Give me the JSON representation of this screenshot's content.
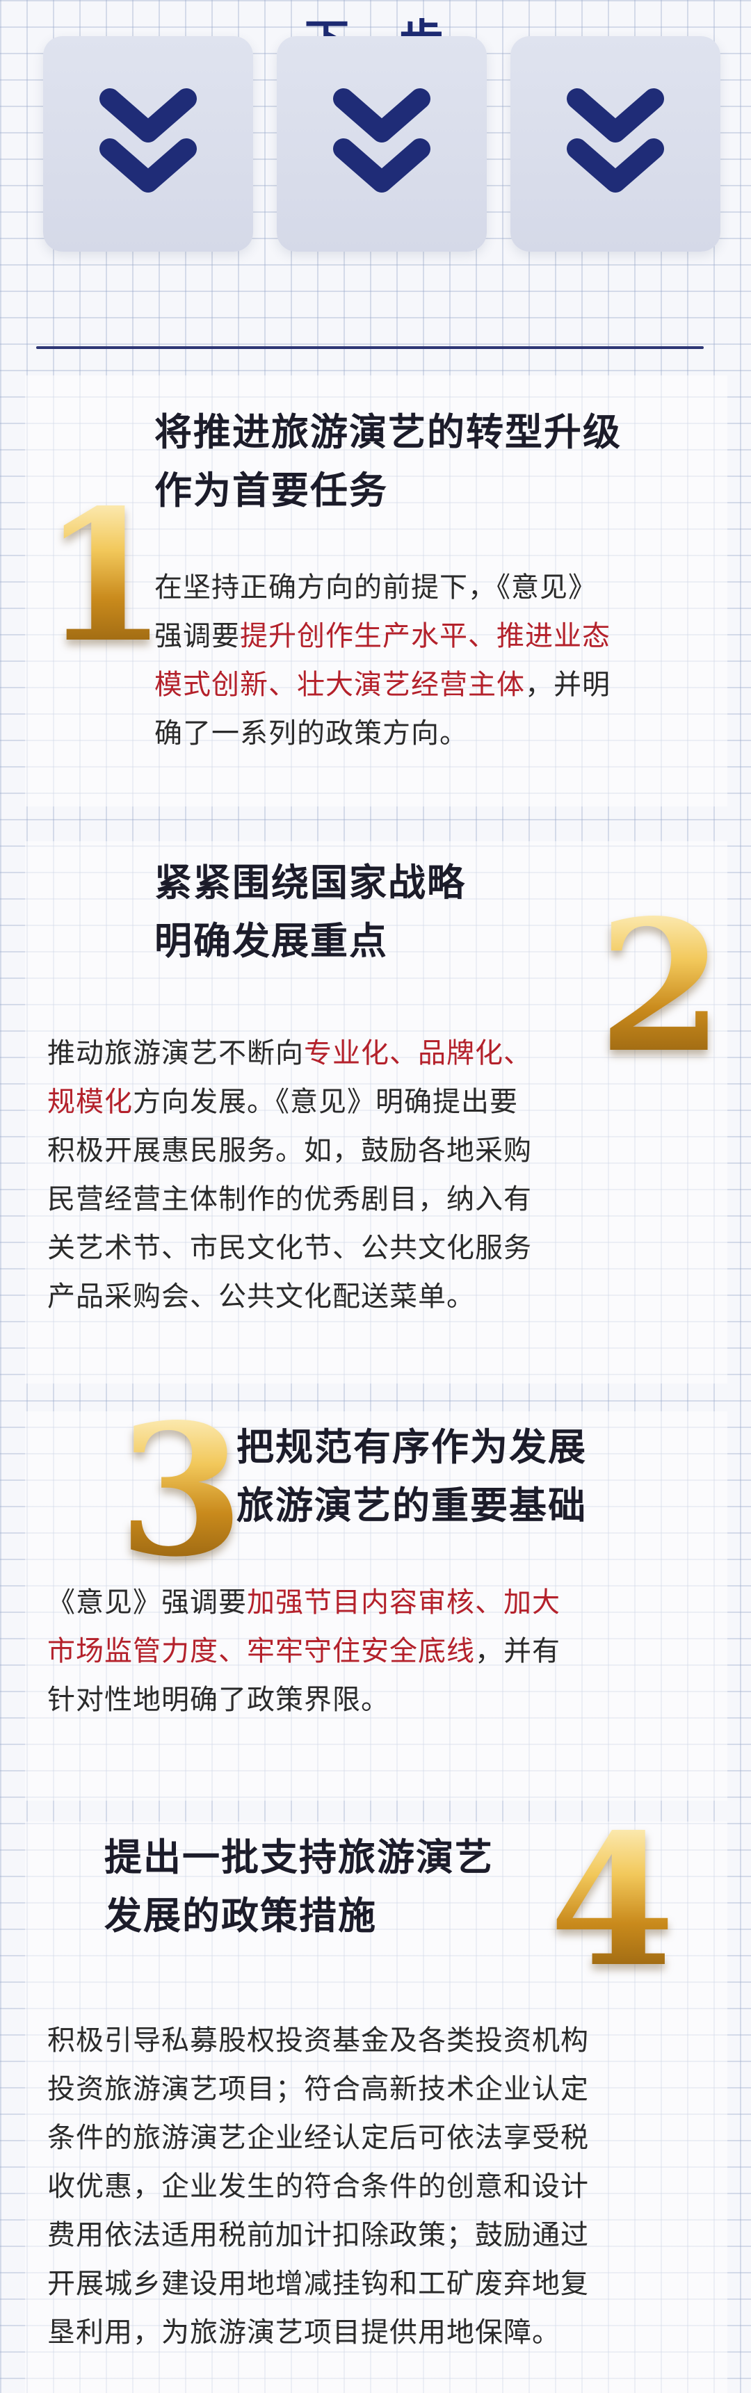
{
  "header": {
    "title": "下一步"
  },
  "sections": [
    {
      "number": "1",
      "heading_lines": [
        "将推进旅游演艺的转型升级",
        "作为首要任务"
      ],
      "body_lines": [
        [
          {
            "t": "在坚持正确方向的前提下，《意见》"
          }
        ],
        [
          {
            "t": "强调要"
          },
          {
            "t": "提升创作生产水平、推进业态",
            "hl": true
          }
        ],
        [
          {
            "t": "模式创新、壮大演艺经营主体",
            "hl": true
          },
          {
            "t": "，并明"
          }
        ],
        [
          {
            "t": "确了一系列的政策方向。"
          }
        ]
      ]
    },
    {
      "number": "2",
      "heading_lines": [
        "紧紧围绕国家战略",
        "明确发展重点"
      ],
      "body_lines": [
        [
          {
            "t": "推动旅游演艺不断向"
          },
          {
            "t": "专业化、品牌化、",
            "hl": true
          }
        ],
        [
          {
            "t": "规模化",
            "hl": true
          },
          {
            "t": "方向发展。《意见》明确提出要"
          }
        ],
        [
          {
            "t": "积极开展惠民服务。如，鼓励各地采购"
          }
        ],
        [
          {
            "t": "民营经营主体制作的优秀剧目，纳入有"
          }
        ],
        [
          {
            "t": "关艺术节、市民文化节、公共文化服务"
          }
        ],
        [
          {
            "t": "产品采购会、公共文化配送菜单。"
          }
        ]
      ]
    },
    {
      "number": "3",
      "heading_lines": [
        "把规范有序作为发展",
        "旅游演艺的重要基础"
      ],
      "body_lines": [
        [
          {
            "t": "《意见》强调要"
          },
          {
            "t": "加强节目内容审核、加大",
            "hl": true
          }
        ],
        [
          {
            "t": "市场监管力度、牢牢守住安全底线",
            "hl": true
          },
          {
            "t": "，并有"
          }
        ],
        [
          {
            "t": "针对性地明确了政策界限。"
          }
        ]
      ]
    },
    {
      "number": "4",
      "heading_lines": [
        "提出一批支持旅游演艺",
        "发展的政策措施"
      ],
      "body_lines": [
        [
          {
            "t": "积极引导私募股权投资基金及各类投资机构"
          }
        ],
        [
          {
            "t": "投资旅游演艺项目；符合高新技术企业认定"
          }
        ],
        [
          {
            "t": "条件的旅游演艺企业经认定后可依法享受税"
          }
        ],
        [
          {
            "t": "收优惠，企业发生的符合条件的创意和设计"
          }
        ],
        [
          {
            "t": "费用依法适用税前加计扣除政策；鼓励通过"
          }
        ],
        [
          {
            "t": "开展城乡建设用地增减挂钩和工矿废弃地复"
          }
        ],
        [
          {
            "t": "垦利用，为旅游演艺项目提供用地保障。"
          }
        ]
      ]
    }
  ],
  "icons": {
    "chevron": "double-chevron-down-icon"
  },
  "colors": {
    "navy": "#1d2a72",
    "highlight": "#b4212b",
    "gold": "#c98a1c"
  }
}
